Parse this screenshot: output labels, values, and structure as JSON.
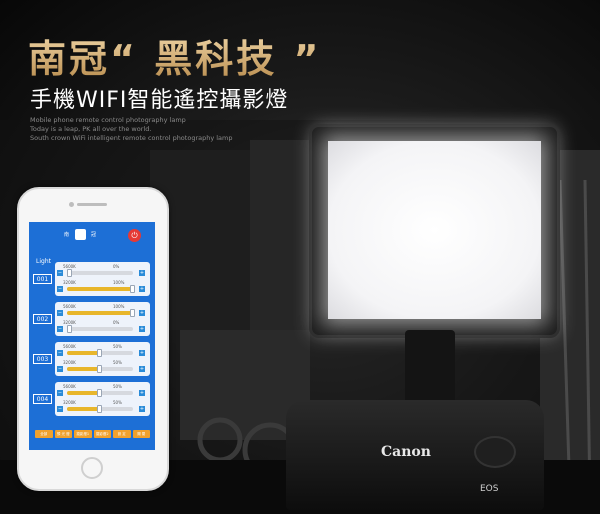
{
  "hero": {
    "headline_brand": "南冠",
    "headline_quote": "“ 黑科技 ”",
    "subheadline": "手機WIFI智能遙控攝影燈",
    "desc_lines": [
      "Mobile phone remote control photography lamp",
      "Today is a leap, PK all over the world.",
      "South crown WiFi intelligent remote control photography lamp"
    ]
  },
  "app": {
    "brand_left": "南",
    "brand_right": "冠",
    "power_icon": "power-icon",
    "light_label": "Light",
    "groups": [
      {
        "id": "001",
        "channels": [
          {
            "label": "5600K",
            "percent_text": "0%",
            "level": 0
          },
          {
            "label": "3200K",
            "percent_text": "100%",
            "level": 1
          }
        ]
      },
      {
        "id": "002",
        "channels": [
          {
            "label": "5600K",
            "percent_text": "100%",
            "level": 1
          },
          {
            "label": "3200K",
            "percent_text": "0%",
            "level": 0
          }
        ]
      },
      {
        "id": "003",
        "channels": [
          {
            "label": "5600K",
            "percent_text": "50%",
            "level": 0.5
          },
          {
            "label": "3200K",
            "percent_text": "50%",
            "level": 0.5
          }
        ]
      },
      {
        "id": "004",
        "channels": [
          {
            "label": "5600K",
            "percent_text": "50%",
            "level": 0.5
          },
          {
            "label": "3200K",
            "percent_text": "50%",
            "level": 0.5
          }
        ]
      }
    ],
    "bottom_buttons": [
      "全部",
      "預 光 燈",
      "攝影燈1",
      "攝影燈2",
      "設 定",
      "關 閉"
    ]
  },
  "camera": {
    "brand": "Canon",
    "model": "EOS"
  },
  "colors": {
    "app_blue": "#1d6fd6",
    "gold": "#d7b37a",
    "slider_fill": "#e8b62b",
    "power_red": "#e53935",
    "bottom_orange": "#f0a12d"
  }
}
